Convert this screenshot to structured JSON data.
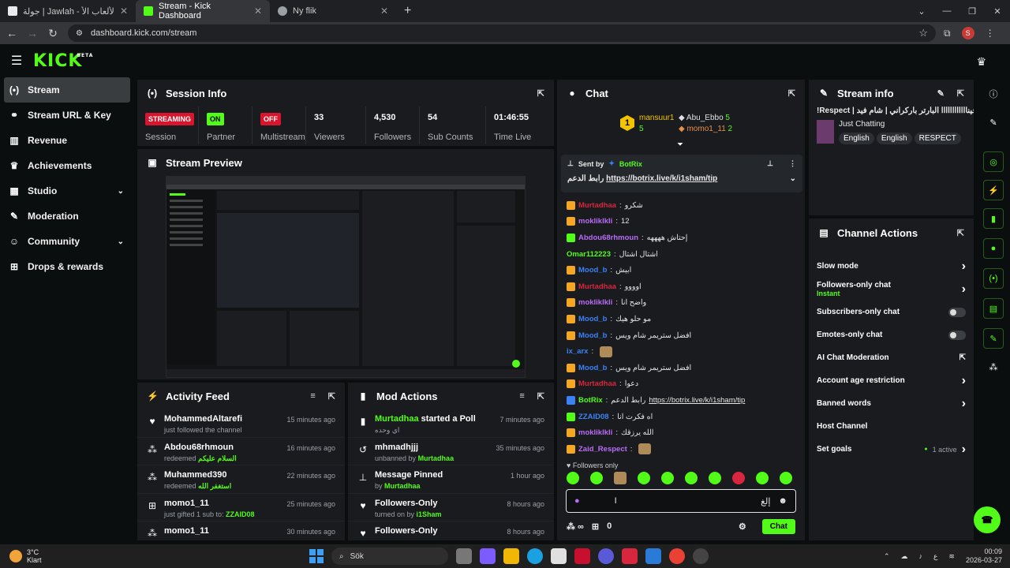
{
  "browser": {
    "tabs": [
      {
        "title": "جولة | Jawlah - منصة الألعاب الأ...",
        "favicon_color": "#e8eaed"
      },
      {
        "title": "Stream - Kick Dashboard",
        "favicon_color": "#53fc18"
      },
      {
        "title": "Ny flik",
        "favicon_color": "#9aa0a6"
      }
    ],
    "url": "dashboard.kick.com/stream",
    "profile_initial": "S"
  },
  "header": {
    "logo": "KICK",
    "logo_badge": "BETA"
  },
  "sidebar": {
    "items": [
      {
        "label": "Stream",
        "icon": "broadcast-icon",
        "glyph": "(•)",
        "active": true
      },
      {
        "label": "Stream URL & Key",
        "icon": "link-icon",
        "glyph": "⚭"
      },
      {
        "label": "Revenue",
        "icon": "chart-icon",
        "glyph": "▥"
      },
      {
        "label": "Achievements",
        "icon": "trophy-icon",
        "glyph": "♛"
      },
      {
        "label": "Studio",
        "icon": "film-icon",
        "glyph": "▦",
        "chevron": true
      },
      {
        "label": "Moderation",
        "icon": "wrench-icon",
        "glyph": "✎"
      },
      {
        "label": "Community",
        "icon": "people-icon",
        "glyph": "☺",
        "chevron": true
      },
      {
        "label": "Drops & rewards",
        "icon": "gift-icon",
        "glyph": "⊞"
      }
    ]
  },
  "session": {
    "title": "Session Info",
    "stats": [
      {
        "value": "STREAMING",
        "label": "Session",
        "badge": "red"
      },
      {
        "value": "ON",
        "label": "Partner",
        "badge": "green"
      },
      {
        "value": "OFF",
        "label": "Multistream",
        "badge": "red"
      },
      {
        "value": "33",
        "label": "Viewers"
      },
      {
        "value": "4,530",
        "label": "Followers"
      },
      {
        "value": "54",
        "label": "Sub Counts"
      },
      {
        "value": "01:46:55",
        "label": "Time Live"
      }
    ]
  },
  "preview": {
    "title": "Stream Preview"
  },
  "activity": {
    "title": "Activity Feed",
    "items": [
      {
        "name": "MohammedAltarefi",
        "sub": "just followed the channel",
        "time": "15 minutes ago",
        "icon": "heart-icon",
        "glyph": "♥"
      },
      {
        "name": "Abdou68rhmoun",
        "sub": "redeemed ",
        "highlight": "السلام عليكم",
        "time": "16 minutes ago",
        "icon": "reward-icon",
        "glyph": "⁂"
      },
      {
        "name": "Muhammed390",
        "sub": "redeemed ",
        "highlight": "استغفر الله",
        "time": "22 minutes ago",
        "icon": "reward-icon",
        "glyph": "⁂"
      },
      {
        "name": "momo1_11",
        "sub": "just gifted 1 sub to: ",
        "highlight": "ZZAID08",
        "time": "25 minutes ago",
        "icon": "gift-icon",
        "glyph": "⊞"
      },
      {
        "name": "momo1_11",
        "sub": "",
        "time": "30 minutes ago",
        "icon": "reward-icon",
        "glyph": "⁂"
      }
    ]
  },
  "mod": {
    "title": "Mod Actions",
    "items": [
      {
        "name_hl": "Murtadhaa",
        "name": " started a Poll",
        "sub": "اي وحده",
        "time": "7 minutes ago",
        "icon": "poll-icon",
        "glyph": "▮"
      },
      {
        "name": "mhmadhjjj",
        "sub": "unbanned by ",
        "highlight": "Murtadhaa",
        "time": "35 minutes ago",
        "icon": "undo-icon",
        "glyph": "↺"
      },
      {
        "name": "Message Pinned",
        "sub": "by ",
        "highlight": "Murtadhaa",
        "time": "1 hour ago",
        "icon": "pin-icon",
        "glyph": "⊥"
      },
      {
        "name": "Followers-Only",
        "sub": "turned on by ",
        "highlight": "i1Sham",
        "time": "8 hours ago",
        "icon": "heart-icon",
        "glyph": "♥"
      },
      {
        "name": "Followers-Only",
        "sub": "",
        "time": "8 hours ago",
        "icon": "heart-icon",
        "glyph": "♥"
      }
    ]
  },
  "chat": {
    "title": "Chat",
    "leaders": [
      {
        "rank": "1",
        "name": "mansuur1",
        "count": "5",
        "color": "#f5c400"
      },
      {
        "name": "Abu_Ebbo",
        "count": "5",
        "color": "#e0e0e0"
      },
      {
        "name": "momo1_11",
        "count": "2",
        "color": "#e6904a"
      }
    ],
    "pinned": {
      "sent_by": "Sent by",
      "user": "BotRix",
      "text": "رابط الدعم",
      "link": "https://botrix.live/k/i1sham/tip"
    },
    "messages": [
      {
        "user": "Murtadhaa",
        "color": "#d7263d",
        "badge": "#f5a623",
        "text": "شكرو"
      },
      {
        "user": "mokliklkli",
        "color": "#b96cf5",
        "badge": "#f5a623",
        "text": "12"
      },
      {
        "user": "Abdou68rhmoun",
        "color": "#b96cf5",
        "badge": "#53fc18",
        "text": "إحتاش ههههه"
      },
      {
        "user": "Omar112223",
        "color": "#53fc18",
        "badge": "",
        "text": "اشتال اشتال"
      },
      {
        "user": "Mood_b",
        "color": "#3b82f6",
        "badge": "#f5a623",
        "text": "ابيش"
      },
      {
        "user": "Murtadhaa",
        "color": "#d7263d",
        "badge": "#f5a623",
        "text": "اوووو"
      },
      {
        "user": "mokliklkli",
        "color": "#b96cf5",
        "badge": "#f5a623",
        "text": "واضح انا"
      },
      {
        "user": "Mood_b",
        "color": "#3b82f6",
        "badge": "#f5a623",
        "text": "مو حلو هيك"
      },
      {
        "user": "Mood_b",
        "color": "#3b82f6",
        "badge": "#f5a623",
        "text": "افضل ستريمر شام ويس"
      },
      {
        "user": "ix_arx",
        "color": "#3b82f6",
        "badge": "",
        "text": "",
        "emote": true
      },
      {
        "user": "Mood_b",
        "color": "#3b82f6",
        "badge": "#f5a623",
        "text": "افضل ستريمر شام ويس"
      },
      {
        "user": "Murtadhaa",
        "color": "#d7263d",
        "badge": "#f5a623",
        "text": "دعوا"
      },
      {
        "user": "BotRix",
        "color": "#53fc18",
        "badge": "#3b82f6",
        "text": "رابط الدعم ",
        "link": "https://botrix.live/k/i1sham/tip"
      },
      {
        "user": "ZZAID08",
        "color": "#3b82f6",
        "badge": "#53fc18",
        "text": "اه فكرت انا"
      },
      {
        "user": "mokliklkli",
        "color": "#b96cf5",
        "badge": "#f5a623",
        "text": "الله يرزقك"
      },
      {
        "user": "Zaid_Respect",
        "color": "#b96cf5",
        "badge": "#f5a623",
        "text": "",
        "emote": true
      }
    ],
    "followers_only": "Followers only",
    "input_placeholder": "إلغ",
    "bottom_count": "0",
    "send_label": "Chat"
  },
  "stream_info": {
    "title": "Stream info",
    "stream_title": "!Respect | جيناااااااااااا البارتر باركراني | شام فيد",
    "category": "Just Chatting",
    "tags": [
      "English",
      "English",
      "RESPECT"
    ]
  },
  "channel_actions": {
    "title": "Channel Actions",
    "items": [
      {
        "label": "Slow mode",
        "control": "chevron"
      },
      {
        "label": "Followers-only chat",
        "sub": "Instant",
        "control": "chevron"
      },
      {
        "label": "Subscribers-only chat",
        "control": "toggle"
      },
      {
        "label": "Emotes-only chat",
        "control": "toggle"
      },
      {
        "label": "AI Chat Moderation",
        "control": "external"
      },
      {
        "label": "Account age restriction",
        "control": "chevron"
      },
      {
        "label": "Banned words",
        "control": "chevron"
      },
      {
        "label": "Host Channel",
        "control": "none"
      },
      {
        "label": "Set goals",
        "control": "chevron",
        "status": "1 active"
      }
    ]
  },
  "taskbar": {
    "temp": "3°C",
    "weather": "Klart",
    "search": "Sök",
    "time": "00:09",
    "date": "2026-03-27"
  }
}
